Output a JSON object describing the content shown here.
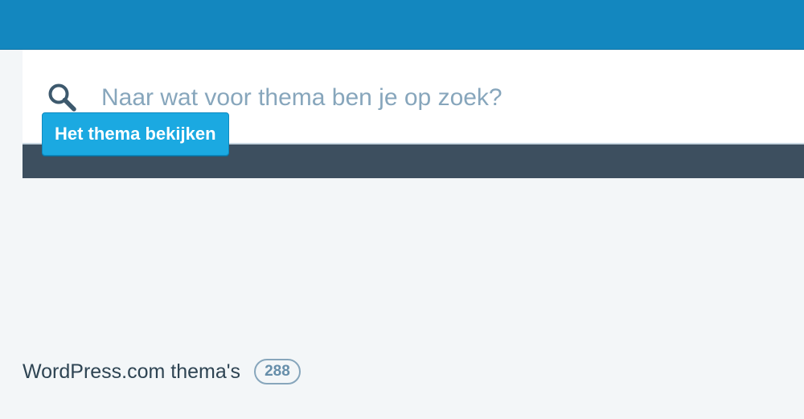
{
  "search": {
    "placeholder": "Naar wat voor thema ben je op zoek?",
    "value": "",
    "icon": "search-icon"
  },
  "preview_button": {
    "label": "Het thema bekijken"
  },
  "section": {
    "title": "WordPress.com thema's",
    "count": "288"
  },
  "colors": {
    "masthead": "#1387bf",
    "strip": "#3d4f5f",
    "button": "#1ba9e1",
    "page_background": "#f3f6f8"
  }
}
